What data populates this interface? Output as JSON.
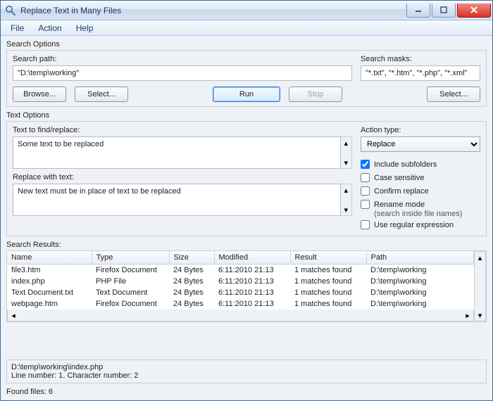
{
  "window": {
    "title": "Replace Text in Many Files"
  },
  "menu": {
    "file": "File",
    "action": "Action",
    "help": "Help"
  },
  "searchOptions": {
    "groupTitle": "Search Options",
    "pathLabel": "Search path:",
    "pathValue": "\"D:\\temp\\working\"",
    "masksLabel": "Search masks:",
    "masksValue": "\"*.txt\", \"*.htm\", \"*.php\", \"*.xml\"",
    "browse": "Browse...",
    "selectPath": "Select...",
    "run": "Run",
    "stop": "Stop",
    "selectMasks": "Select..."
  },
  "textOptions": {
    "groupTitle": "Text Options",
    "findLabel": "Text to find/replace:",
    "findValue": "Some text to be replaced",
    "replaceLabel": "Replace with text:",
    "replaceValue": "New text must be in place of text to be replaced",
    "actionTypeLabel": "Action type:",
    "actionTypeValue": "Replace",
    "checks": {
      "includeSub": "Include subfolders",
      "caseSensitive": "Case sensitive",
      "confirmReplace": "Confirm replace",
      "renameMode": "Rename mode",
      "renameModeSub": "(search inside file names)",
      "useRegex": "Use regular expression"
    }
  },
  "results": {
    "groupTitle": "Search Results:",
    "columns": {
      "name": "Name",
      "type": "Type",
      "size": "Size",
      "modified": "Modified",
      "result": "Result",
      "path": "Path"
    },
    "rows": [
      {
        "name": "file3.htm",
        "type": "Firefox Document",
        "size": "24 Bytes",
        "modified": "6:11:2010  21:13",
        "result": "1 matches found",
        "path": "D:\\temp\\working"
      },
      {
        "name": "index.php",
        "type": "PHP File",
        "size": "24 Bytes",
        "modified": "6:11:2010  21:13",
        "result": "1 matches found",
        "path": "D:\\temp\\working"
      },
      {
        "name": "Text Document.txt",
        "type": "Text Document",
        "size": "24 Bytes",
        "modified": "6:11:2010  21:13",
        "result": "1 matches found",
        "path": "D:\\temp\\working"
      },
      {
        "name": "webpage.htm",
        "type": "Firefox Document",
        "size": "24 Bytes",
        "modified": "6:11:2010  21:13",
        "result": "1 matches found",
        "path": "D:\\temp\\working"
      }
    ]
  },
  "status": {
    "line1": "D:\\temp\\working\\index.php",
    "line2": "Line number: 1. Character number: 2"
  },
  "footer": {
    "found": "Found files: 6"
  }
}
